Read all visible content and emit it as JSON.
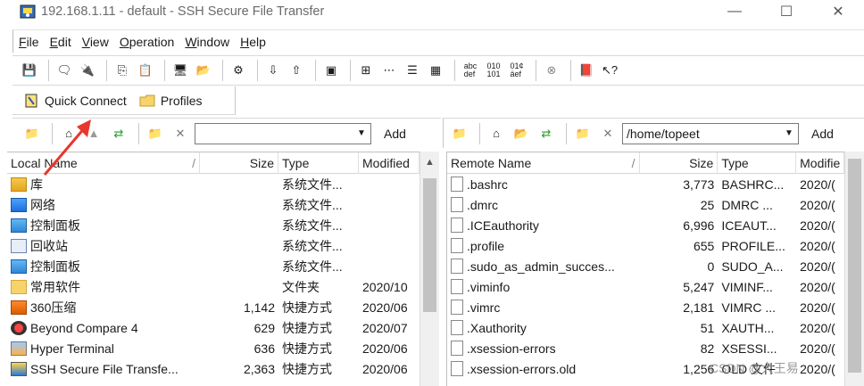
{
  "window": {
    "title": "192.168.1.11 - default - SSH Secure File Transfer",
    "controls": [
      "—",
      "☐",
      "✕"
    ]
  },
  "menu": [
    {
      "label": "File",
      "key": "F",
      "rest": "ile"
    },
    {
      "label": "Edit",
      "key": "E",
      "rest": "dit"
    },
    {
      "label": "View",
      "key": "V",
      "rest": "iew"
    },
    {
      "label": "Operation",
      "key": "O",
      "rest": "peration"
    },
    {
      "label": "Window",
      "key": "W",
      "rest": "indow"
    },
    {
      "label": "Help",
      "key": "H",
      "rest": "elp"
    }
  ],
  "quickbar": {
    "quick_connect": "Quick Connect",
    "profiles": "Profiles"
  },
  "local": {
    "path": "",
    "add_label": "Add",
    "columns": [
      "Local Name",
      "Size",
      "Type",
      "Modified"
    ],
    "rows": [
      {
        "name": "库",
        "size": "",
        "type": "系统文件...",
        "modified": "",
        "icon": "library-icon"
      },
      {
        "name": "网络",
        "size": "",
        "type": "系统文件...",
        "modified": "",
        "icon": "network-icon"
      },
      {
        "name": "控制面板",
        "size": "",
        "type": "系统文件...",
        "modified": "",
        "icon": "control-panel-icon"
      },
      {
        "name": "回收站",
        "size": "",
        "type": "系统文件...",
        "modified": "",
        "icon": "recycle-bin-icon"
      },
      {
        "name": "控制面板",
        "size": "",
        "type": "系统文件...",
        "modified": "",
        "icon": "control-panel-icon"
      },
      {
        "name": "常用软件",
        "size": "",
        "type": "文件夹",
        "modified": "2020/10",
        "icon": "folder-icon"
      },
      {
        "name": "360压缩",
        "size": "1,142",
        "type": "快捷方式",
        "modified": "2020/06",
        "icon": "360-zip-icon"
      },
      {
        "name": "Beyond Compare 4",
        "size": "629",
        "type": "快捷方式",
        "modified": "2020/07",
        "icon": "beyond-compare-icon"
      },
      {
        "name": "Hyper Terminal",
        "size": "636",
        "type": "快捷方式",
        "modified": "2020/06",
        "icon": "hyper-terminal-icon"
      },
      {
        "name": "SSH Secure File Transfe...",
        "size": "2,363",
        "type": "快捷方式",
        "modified": "2020/06",
        "icon": "ssh-transfer-icon"
      }
    ]
  },
  "remote": {
    "path": "/home/topeet",
    "add_label": "Add",
    "columns": [
      "Remote Name",
      "Size",
      "Type",
      "Modifie"
    ],
    "rows": [
      {
        "name": ".bashrc",
        "size": "3,773",
        "type": "BASHRC...",
        "modified": "2020/("
      },
      {
        "name": ".dmrc",
        "size": "25",
        "type": "DMRC ...",
        "modified": "2020/("
      },
      {
        "name": ".ICEauthority",
        "size": "6,996",
        "type": "ICEAUT...",
        "modified": "2020/("
      },
      {
        "name": ".profile",
        "size": "655",
        "type": "PROFILE...",
        "modified": "2020/("
      },
      {
        "name": ".sudo_as_admin_succes...",
        "size": "0",
        "type": "SUDO_A...",
        "modified": "2020/("
      },
      {
        "name": ".viminfo",
        "size": "5,247",
        "type": "VIMINF...",
        "modified": "2020/("
      },
      {
        "name": ".vimrc",
        "size": "2,181",
        "type": "VIMRC ...",
        "modified": "2020/("
      },
      {
        "name": ".Xauthority",
        "size": "51",
        "type": "XAUTH...",
        "modified": "2020/("
      },
      {
        "name": ".xsession-errors",
        "size": "82",
        "type": "XSESSI...",
        "modified": "2020/("
      },
      {
        "name": ".xsession-errors.old",
        "size": "1,256",
        "type": "OLD 文件",
        "modified": "2020/("
      }
    ]
  },
  "watermark": "CSDN @大王易",
  "colors": {
    "annotation_arrow": "#e8372c",
    "title_text": "#6b6b6b"
  }
}
